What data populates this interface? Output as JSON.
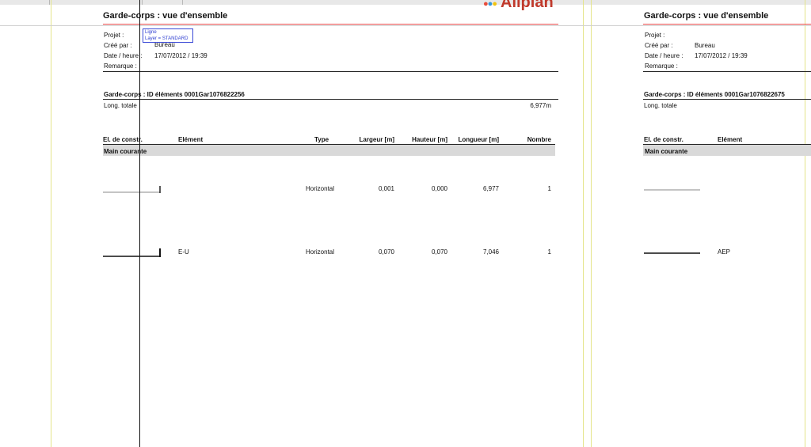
{
  "logo": {
    "text": "Allplan"
  },
  "tooltip": {
    "line1": "Ligne",
    "line2": "Layer = STANDARD"
  },
  "page_left": {
    "title": "Garde-corps : vue d'ensemble",
    "info_labels": [
      "Projet :",
      "Créé par :",
      "Date / heure :",
      "Remarque :"
    ],
    "created_by": "Bureau",
    "datetime": "17/07/2012  /  19:39",
    "section_title": "Garde-corps : ID éléments 0001Gar1076822256",
    "total_label": "Long. totale",
    "total_value": "6,977m",
    "headers": [
      "El. de constr.",
      "Elément",
      "Type",
      "Largeur [m]",
      "Hauteur [m]",
      "Longueur [m]",
      "Nombre"
    ],
    "group_label": "Main courante",
    "rows": [
      {
        "element": "",
        "type": "Horizontal",
        "largeur": "0,001",
        "hauteur": "0,000",
        "longueur": "6,977",
        "nombre": "1"
      },
      {
        "element": "E-U",
        "type": "Horizontal",
        "largeur": "0,070",
        "hauteur": "0,070",
        "longueur": "7,046",
        "nombre": "1"
      }
    ]
  },
  "page_right": {
    "title": "Garde-corps : vue d'ensemble",
    "info_labels": [
      "Projet :",
      "Créé par :",
      "Date / heure :",
      "Remarque :"
    ],
    "created_by": "Bureau",
    "datetime": "17/07/2012  /  19:39",
    "section_title": "Garde-corps : ID éléments 0001Gar1076822675",
    "total_label": "Long. totale",
    "headers": [
      "El. de constr.",
      "Elément"
    ],
    "group_label": "Main courante",
    "rows": [
      {
        "element": ""
      },
      {
        "element": "AEP"
      }
    ]
  },
  "colors": {
    "margin_guide": "#e4e48a",
    "cursor_line": "#111111",
    "red_guide": "#e84a4a",
    "tooltip_border": "#3a49d6",
    "band": "#d9d9d9"
  }
}
